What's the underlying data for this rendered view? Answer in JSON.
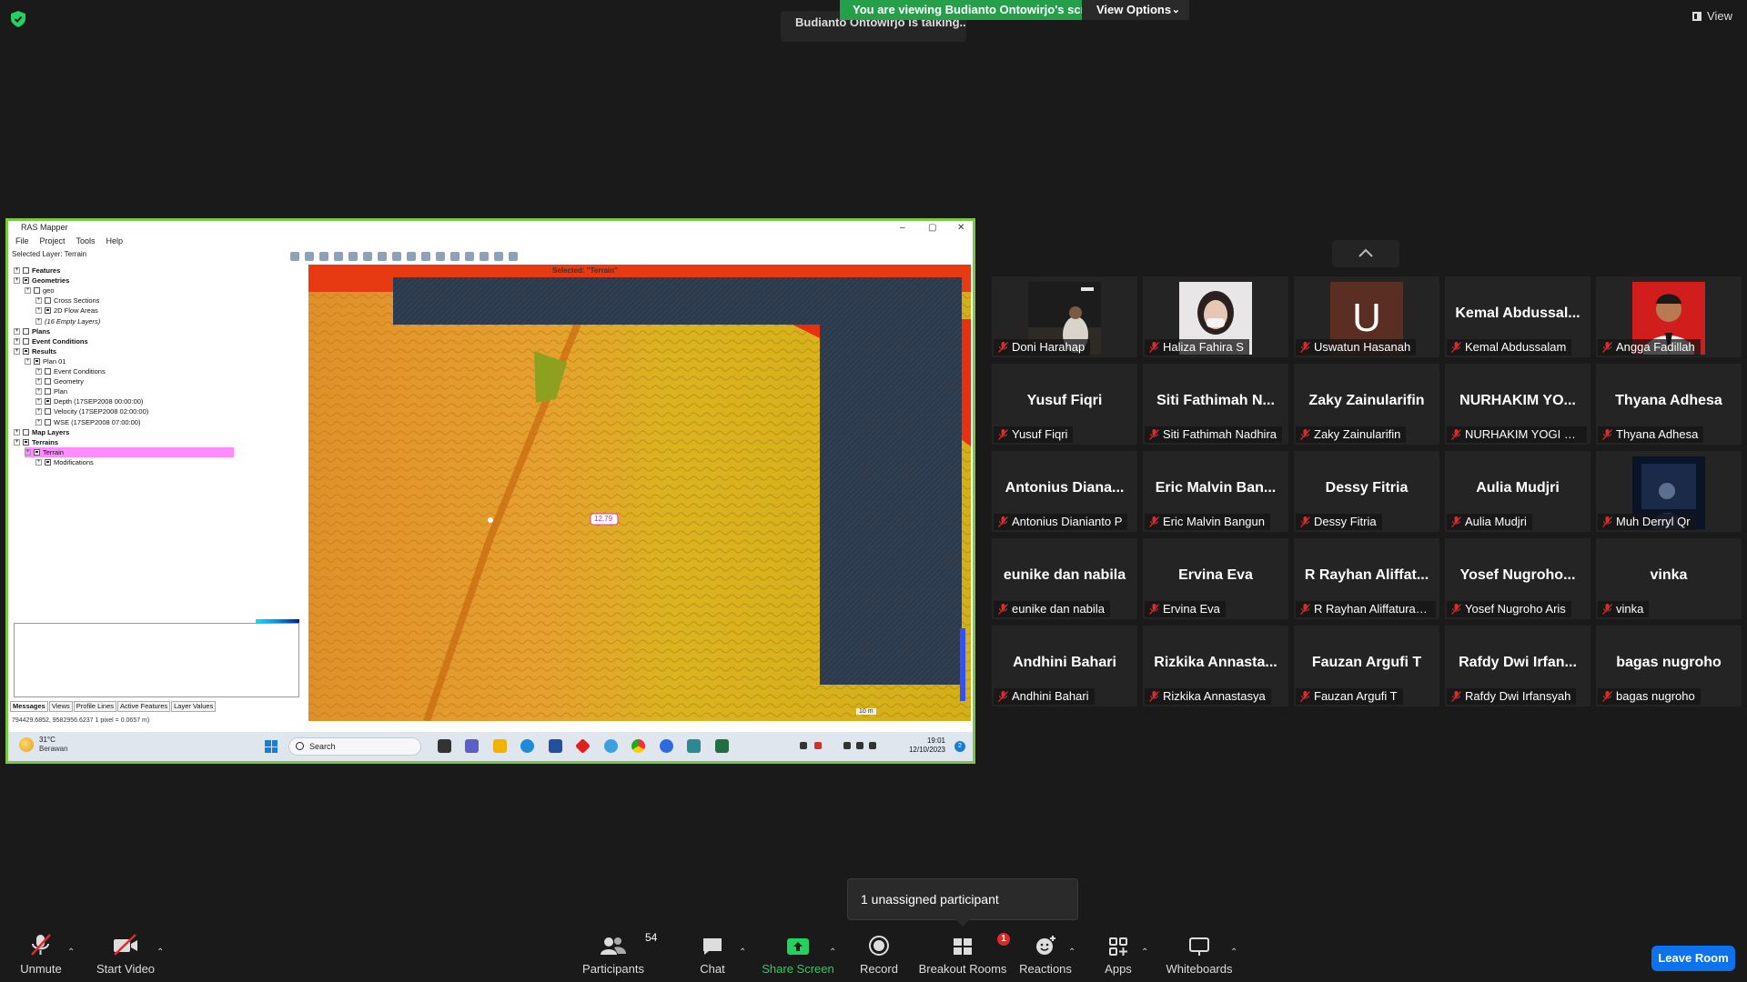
{
  "banner": {
    "viewing": "You are viewing Budianto Ontowirjo's screen",
    "view_options": "View Options",
    "talking": "Budianto Ontowirjo is talking...",
    "view": "View"
  },
  "shared_screen": {
    "app_title": "RAS Mapper",
    "menu": [
      "File",
      "Project",
      "Tools",
      "Help"
    ],
    "selected_layer": "Selected Layer: Terrain",
    "map_selected": "Selected: \"Terrain\"",
    "map_value_label": "12.79",
    "scale_label": "10 m",
    "tree": [
      {
        "text": "Features",
        "bold": true,
        "checked": false,
        "indent": 0
      },
      {
        "text": "Geometries",
        "bold": true,
        "checked": true,
        "indent": 0
      },
      {
        "text": "geo",
        "bold": false,
        "checked": false,
        "indent": 1
      },
      {
        "text": "Cross Sections",
        "bold": false,
        "checked": false,
        "indent": 2
      },
      {
        "text": "2D Flow Areas",
        "bold": false,
        "checked": true,
        "indent": 2
      },
      {
        "text": "(16 Empty Layers)",
        "bold": false,
        "checked": null,
        "indent": 2
      },
      {
        "text": "Plans",
        "bold": true,
        "checked": false,
        "indent": 0
      },
      {
        "text": "Event Conditions",
        "bold": true,
        "checked": false,
        "indent": 0
      },
      {
        "text": "Results",
        "bold": true,
        "checked": true,
        "indent": 0
      },
      {
        "text": "Plan 01",
        "bold": false,
        "checked": true,
        "indent": 1
      },
      {
        "text": "Event Conditions",
        "bold": false,
        "checked": false,
        "indent": 2
      },
      {
        "text": "Geometry",
        "bold": false,
        "checked": false,
        "indent": 2
      },
      {
        "text": "Plan",
        "bold": false,
        "checked": false,
        "indent": 2
      },
      {
        "text": "Depth (17SEP2008 00:00:00)",
        "bold": false,
        "checked": true,
        "indent": 2
      },
      {
        "text": "Velocity (17SEP2008 02:00:00)",
        "bold": false,
        "checked": false,
        "indent": 2
      },
      {
        "text": "WSE (17SEP2008 07:00:00)",
        "bold": false,
        "checked": false,
        "indent": 2
      },
      {
        "text": "Map Layers",
        "bold": true,
        "checked": false,
        "indent": 0
      },
      {
        "text": "Terrains",
        "bold": true,
        "checked": true,
        "indent": 0
      },
      {
        "text": "Terrain",
        "bold": false,
        "checked": true,
        "indent": 1,
        "highlight": true
      },
      {
        "text": "Modifications",
        "bold": false,
        "checked": true,
        "indent": 2
      }
    ],
    "tabs": [
      "Messages",
      "Views",
      "Profile Lines",
      "Active Features",
      "Layer Values"
    ],
    "coord_status": "794429.6852, 9582956.6237   1 pixel = 0.0657 m)",
    "taskbar": {
      "temp": "31°C",
      "condition": "Berawan",
      "search": "Search",
      "time": "19:01",
      "date": "12/10/2023",
      "notif": "2"
    }
  },
  "participants": [
    {
      "big": "",
      "label": "Doni Harahap",
      "photo": "doni"
    },
    {
      "big": "",
      "label": "Haliza Fahira S",
      "photo": "haliza"
    },
    {
      "big": "",
      "label": "Uswatun Hasanah",
      "avatar": "U"
    },
    {
      "big": "Kemal  Abdussal...",
      "label": "Kemal Abdussalam"
    },
    {
      "big": "",
      "label": "Angga Fadillah",
      "photo": "angga"
    },
    {
      "big": "Yusuf Fiqri",
      "label": "Yusuf Fiqri"
    },
    {
      "big": "Siti Fathimah N...",
      "label": "Siti Fathimah Nadhira"
    },
    {
      "big": "Zaky Zainularifin",
      "label": "Zaky Zainularifin"
    },
    {
      "big": "NURHAKIM YO...",
      "label": "NURHAKIM YOGI FAH..."
    },
    {
      "big": "Thyana Adhesa",
      "label": "Thyana Adhesa"
    },
    {
      "big": "Antonius  Diana...",
      "label": "Antonius Dianianto P"
    },
    {
      "big": "Eric Malvin Ban...",
      "label": "Eric Malvin Bangun"
    },
    {
      "big": "Dessy Fitria",
      "label": "Dessy Fitria"
    },
    {
      "big": "Aulia Mudjri",
      "label": "Aulia Mudjri"
    },
    {
      "big": "",
      "label": "Muh Derryl Qr",
      "photo": "derryl"
    },
    {
      "big": "eunike dan nabila",
      "label": "eunike dan nabila"
    },
    {
      "big": "Ervina Eva",
      "label": "Ervina Eva"
    },
    {
      "big": "R Rayhan Aliffat...",
      "label": "R Rayhan Aliffaturah..."
    },
    {
      "big": "Yosef  Nugroho...",
      "label": "Yosef Nugroho Aris"
    },
    {
      "big": "vinka",
      "label": "vinka"
    },
    {
      "big": "Andhini Bahari",
      "label": "Andhini Bahari"
    },
    {
      "big": "Rizkika  Annasta...",
      "label": "Rizkika Annastasya"
    },
    {
      "big": "Fauzan Argufi T",
      "label": "Fauzan Argufi T"
    },
    {
      "big": "Rafdy Dwi Irfan...",
      "label": "Rafdy Dwi Irfansyah"
    },
    {
      "big": "bagas nugroho",
      "label": "bagas nugroho"
    }
  ],
  "popup": {
    "unassigned": "1 unassigned participant"
  },
  "toolbar": {
    "unmute": "Unmute",
    "start_video": "Start Video",
    "participants": "Participants",
    "participants_count": "54",
    "chat": "Chat",
    "share_screen": "Share Screen",
    "record": "Record",
    "breakout_rooms": "Breakout Rooms",
    "breakout_badge": "1",
    "reactions": "Reactions",
    "apps": "Apps",
    "whiteboards": "Whiteboards",
    "leave_room": "Leave Room"
  },
  "colors": {
    "share_green": "#23a049",
    "leave_blue": "#0e72ed",
    "muted_red": "#e02828"
  }
}
